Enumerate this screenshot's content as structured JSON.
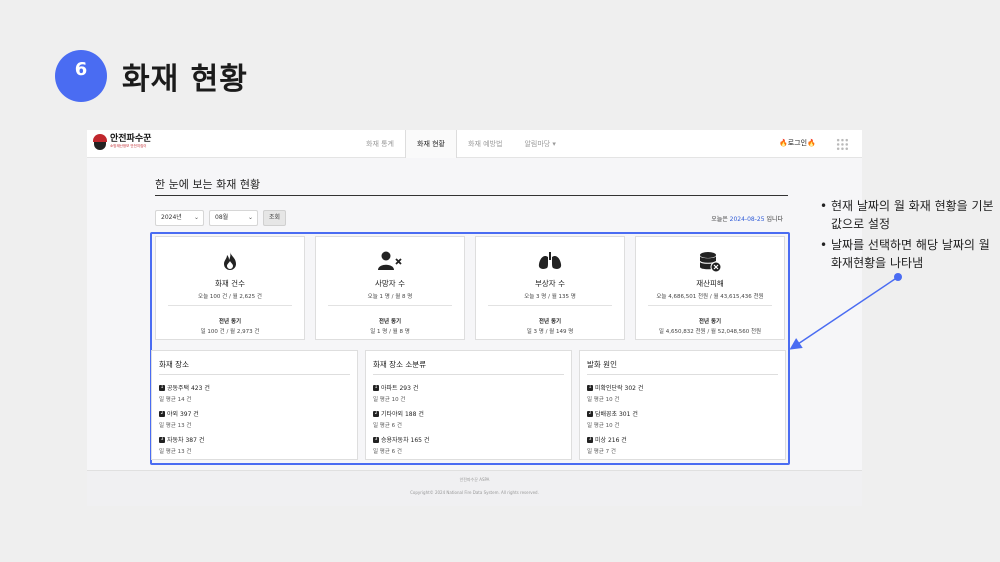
{
  "slide": {
    "number": "6",
    "title": "화재 현황"
  },
  "nav": {
    "logo_name": "안전파수꾼",
    "logo_sub": "소방재난정보 안전지킴이",
    "tabs": [
      "화재 통계",
      "화재 현황",
      "화재 예방법",
      "알림마당"
    ],
    "active_tab": 1,
    "login_label": "로그인"
  },
  "page": {
    "heading": "한 눈에 보는 화재 현황",
    "year_select": "2024년",
    "month_select": "08월",
    "query_button": "조회",
    "today_prefix": "오늘은 ",
    "today_date": "2024-08-25",
    "today_suffix": " 입니다"
  },
  "stats": [
    {
      "icon": "fire-icon",
      "label": "화재 건수",
      "value": "오늘 100 건 / 월 2,625 건",
      "prev_label": "전년 동기",
      "prev_value": "일 100 건 / 월 2,973 건"
    },
    {
      "icon": "person-x-icon",
      "label": "사망자 수",
      "value": "오늘 1 명 / 월 8 명",
      "prev_label": "전년 동기",
      "prev_value": "일 1 명 / 월 8 명"
    },
    {
      "icon": "lungs-icon",
      "label": "부상자 수",
      "value": "오늘 3 명 / 월 135 명",
      "prev_label": "전년 동기",
      "prev_value": "일 3 명 / 월 149 명"
    },
    {
      "icon": "coins-x-icon",
      "label": "재산피해",
      "value": "오늘 4,686,501 천원 / 월 43,615,436 천원",
      "prev_label": "전년 동기",
      "prev_value": "일 4,650,832 천원 / 월 52,048,560 천원"
    }
  ],
  "lists": [
    {
      "title": "화재 장소",
      "items": [
        {
          "rank": "1",
          "text": "공동주택 423 건",
          "avg": "일 평균 14 건"
        },
        {
          "rank": "2",
          "text": "야외 397 건",
          "avg": "일 평균 13 건"
        },
        {
          "rank": "3",
          "text": "자동차 387 건",
          "avg": "일 평균 13 건"
        }
      ]
    },
    {
      "title": "화재 장소 소분류",
      "items": [
        {
          "rank": "1",
          "text": "아파트 293 건",
          "avg": "일 평균 10 건"
        },
        {
          "rank": "2",
          "text": "기타야외 188 건",
          "avg": "일 평균 6 건"
        },
        {
          "rank": "3",
          "text": "승용자동차 165 건",
          "avg": "일 평균 6 건"
        }
      ]
    },
    {
      "title": "발화 원인",
      "items": [
        {
          "rank": "1",
          "text": "미확인단락 302 건",
          "avg": "일 평균 10 건"
        },
        {
          "rank": "2",
          "text": "담배꽁초 301 건",
          "avg": "일 평균 10 건"
        },
        {
          "rank": "3",
          "text": "미상 216 건",
          "avg": "일 평균 7 건"
        }
      ]
    }
  ],
  "footer": {
    "line1": "안전파수꾼 ASPA",
    "line2": "Copyright© 2024 National Fire Data System. All rights reserved."
  },
  "annotation": [
    "현재 날짜의 월 화재 현황을 기본값으로 설정",
    "날짜를 선택하면 해당 날짜의 월 화재현황을 나타냄"
  ],
  "colors": {
    "accent": "#4a6cf2",
    "brand_red": "#c0272d",
    "date_blue": "#2f5bd8"
  }
}
